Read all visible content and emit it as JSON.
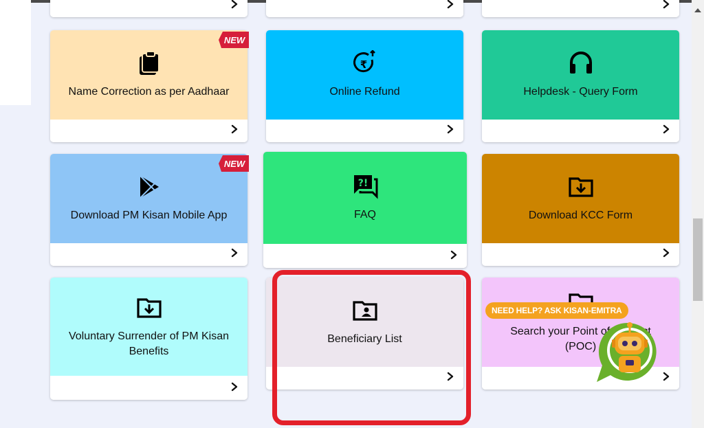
{
  "cards": {
    "name_correction": {
      "title": "Name Correction as per Aadhaar",
      "badge": "NEW",
      "color": "#ffe3b3"
    },
    "online_refund": {
      "title": "Online Refund",
      "color": "#00bfff"
    },
    "helpdesk": {
      "title": "Helpdesk - Query Form",
      "color": "#20c997"
    },
    "download_app": {
      "title": "Download PM Kisan Mobile App",
      "badge": "NEW",
      "color": "#8ec5f6"
    },
    "faq": {
      "title": "FAQ",
      "color": "#2ee57c"
    },
    "download_kcc": {
      "title": "Download KCC Form",
      "color": "#cc8400"
    },
    "voluntary_surrender": {
      "title": "Voluntary Surrender of PM Kisan Benefits",
      "color": "#b0fcfc"
    },
    "beneficiary_list": {
      "title": "Beneficiary List",
      "color": "#ede6ee"
    },
    "search_poc": {
      "title": "Search your Point of Contact (POC)",
      "color": "#f3c5fb"
    }
  },
  "icons": {
    "name_correction": "clipboard-icon",
    "online_refund": "rupee-refund-icon",
    "helpdesk": "headphones-icon",
    "download_app": "play-store-icon",
    "faq": "faq-chat-icon",
    "download_kcc": "folder-download-icon",
    "voluntary_surrender": "folder-download-icon",
    "beneficiary_list": "folder-user-icon",
    "search_poc": "folder-icon"
  },
  "chatbot": {
    "label": "NEED HELP? ASK KISAN-EMITRA",
    "badge_color": "#f4a21f",
    "bot_color": "#6ab02b"
  },
  "highlight_color": "#e3202a"
}
